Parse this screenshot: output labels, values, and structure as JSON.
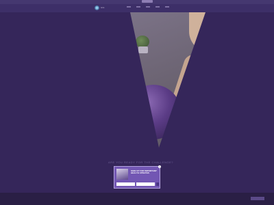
{
  "topbar": {
    "cta_label": ""
  },
  "header": {
    "logo_text": "tums",
    "nav_items": [
      "",
      "",
      "",
      "",
      ""
    ]
  },
  "hero": {
    "question": "ARE YOU READY FOR THE CHALLENGE?",
    "right_text": ""
  },
  "popup": {
    "title": "SIGN UP FOR IMPORTANT HEALTH UPDATES",
    "close_label": "×",
    "name_placeholder": "",
    "email_placeholder": "",
    "submit_label": ""
  },
  "cookie": {
    "text": "",
    "button_label": ""
  },
  "colors": {
    "overlay": "#35265a",
    "popup_bg": "#7256b3",
    "accent": "#4a3585"
  }
}
